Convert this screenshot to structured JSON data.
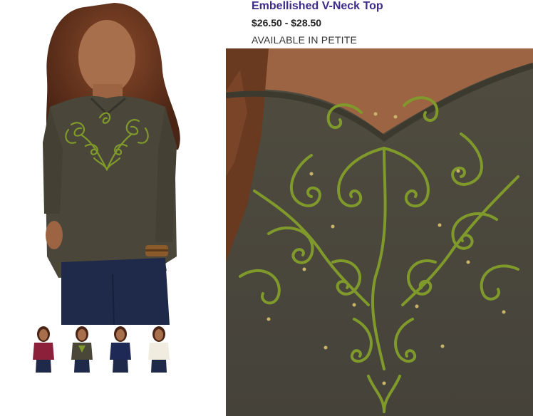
{
  "product": {
    "title": "Embellished V-Neck Top",
    "price": "$26.50 - $28.50",
    "availability": "AVAILABLE IN PETITE"
  },
  "thumbnails": [
    {
      "icon": "thumbnail-burgundy",
      "color": "#8c1f3a"
    },
    {
      "icon": "thumbnail-olive",
      "color": "#4a4638"
    },
    {
      "icon": "thumbnail-navy",
      "color": "#1e2a55"
    },
    {
      "icon": "thumbnail-ivory",
      "color": "#f1ece0"
    }
  ],
  "colors": {
    "shirt": "#4a463a",
    "embroidery": "#7f9a2a",
    "title": "#3d2a8a"
  }
}
